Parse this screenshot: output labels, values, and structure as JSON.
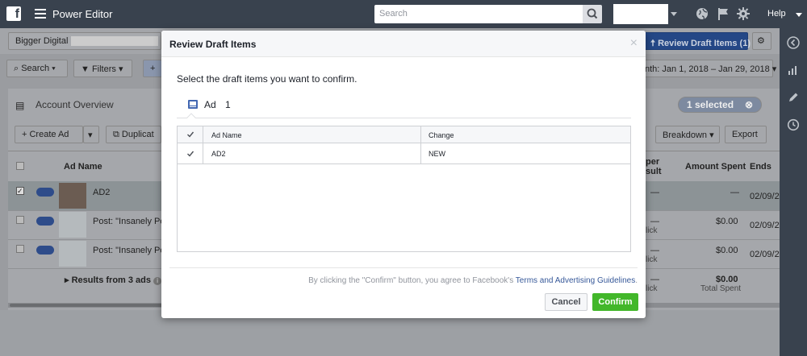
{
  "topbar": {
    "app_title": "Power Editor",
    "search_placeholder": "Search",
    "help_label": "Help"
  },
  "background": {
    "account_name": "Bigger Digital",
    "review_button": "Review Draft Items (1)",
    "search_button": "Search",
    "filters_button": "Filters",
    "date_range": "nth: Jan 1, 2018 – Jan 29, 2018",
    "section_title": "Account Overview",
    "selected_badge": "1 selected",
    "create_ad_button": "Create Ad",
    "duplicate_button": "Duplicat",
    "breakdown_button": "Breakdown",
    "export_button": "Export",
    "columns": {
      "ad_name": "Ad Name",
      "per_result": "per\nsult",
      "amount_spent": "Amount Spent",
      "ends": "Ends"
    },
    "rows": [
      {
        "name": "AD2",
        "dash": "—",
        "amount": "—",
        "ends": "02/09/2"
      },
      {
        "name": "Post: \"Insanely Pow",
        "dash": "—",
        "sub": "lick",
        "amount": "$0.00",
        "ends": "02/09/2"
      },
      {
        "name": "Post: \"Insanely Pow",
        "dash": "—",
        "sub": "lick",
        "amount": "$0.00",
        "ends": "02/09/2"
      }
    ],
    "results_label": "Results from 3 ads",
    "total_dash": "—",
    "total_sub": "lick",
    "total_amount": "$0.00",
    "total_label": "Total Spent"
  },
  "modal": {
    "title": "Review Draft Items",
    "close": "×",
    "subtitle": "Select the draft items you want to confirm.",
    "tab_label": "Ad",
    "tab_count": "1",
    "table": {
      "headers": [
        "Ad Name",
        "Change"
      ],
      "rows": [
        {
          "name": "AD2",
          "change": "NEW",
          "checked": true
        }
      ]
    },
    "legal_prefix": "By clicking the \"Confirm\" button, you agree to Facebook's ",
    "legal_link": "Terms and Advertising Guidelines",
    "legal_suffix": ".",
    "cancel_label": "Cancel",
    "confirm_label": "Confirm"
  },
  "colors": {
    "topbar": "#39424e",
    "primary": "#4267b2",
    "confirm": "#42b72a"
  }
}
